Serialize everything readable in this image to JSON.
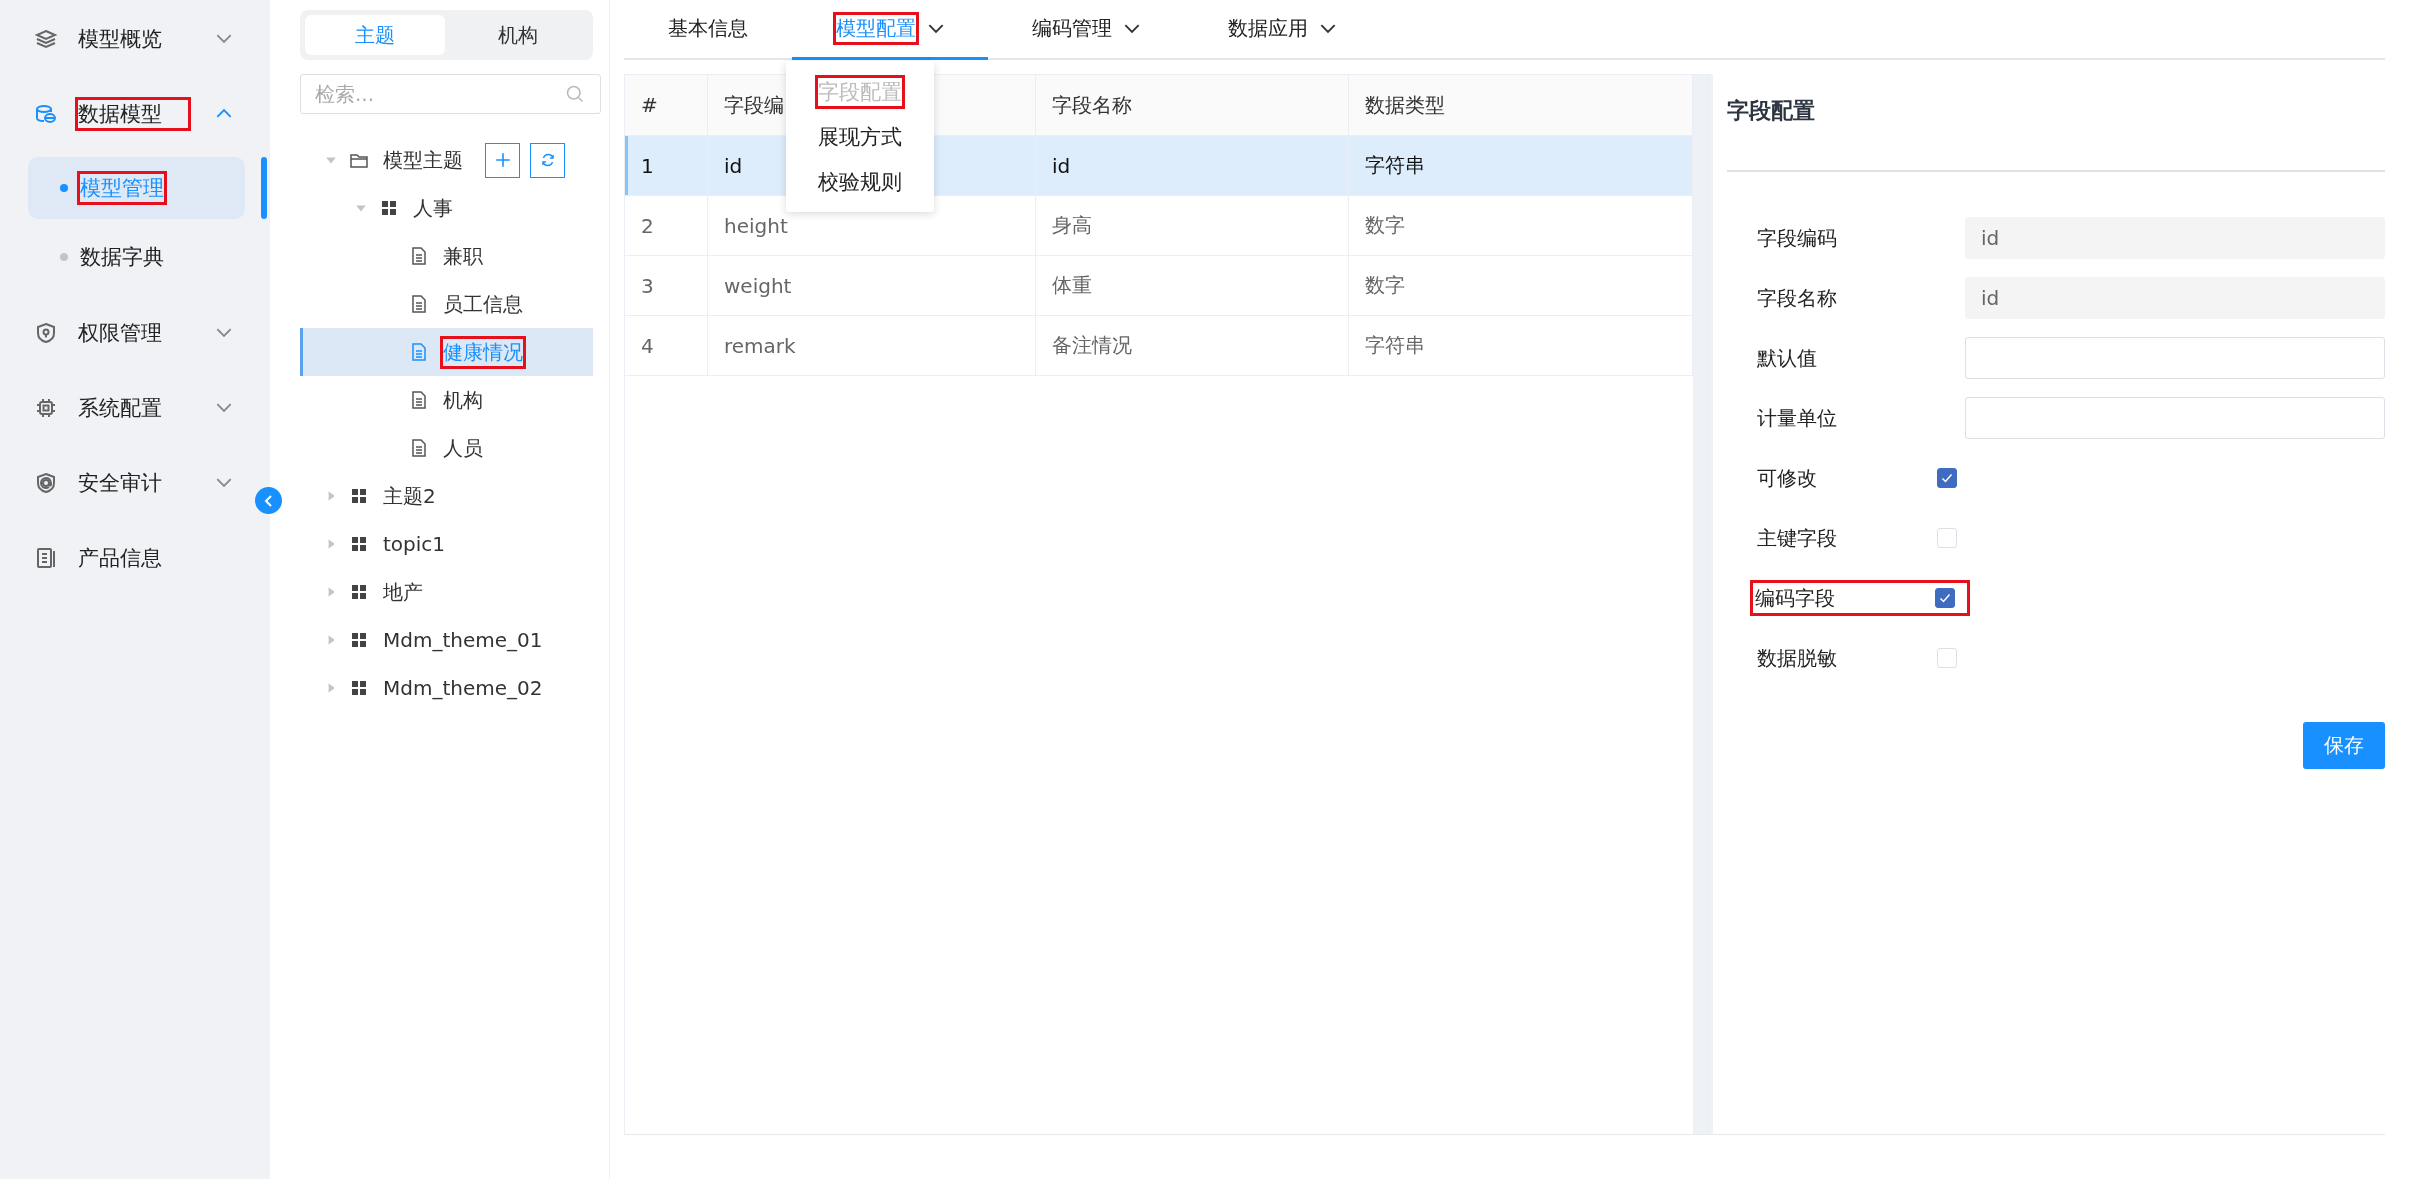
{
  "sidebar": {
    "items": [
      {
        "label": "模型概览",
        "expanded": false,
        "highlighted": false
      },
      {
        "label": "数据模型",
        "expanded": true,
        "highlighted": true,
        "children": [
          {
            "label": "模型管理",
            "selected": true,
            "highlighted": true
          },
          {
            "label": "数据字典",
            "selected": false,
            "highlighted": false
          }
        ]
      },
      {
        "label": "权限管理",
        "expanded": false,
        "highlighted": false
      },
      {
        "label": "系统配置",
        "expanded": false,
        "highlighted": false
      },
      {
        "label": "安全审计",
        "expanded": false,
        "highlighted": false
      },
      {
        "label": "产品信息",
        "highlighted": false
      }
    ]
  },
  "tree_panel": {
    "segments": [
      {
        "label": "主题",
        "selected": true
      },
      {
        "label": "机构",
        "selected": false
      }
    ],
    "search": {
      "placeholder": "检索..."
    },
    "nodes": [
      {
        "label": "模型主题",
        "kind": "folder",
        "expanded": true,
        "selected": false,
        "highlighted": false,
        "children": [
          {
            "label": "人事",
            "kind": "group",
            "expanded": true,
            "selected": false,
            "highlighted": false,
            "children": [
              {
                "label": "兼职",
                "kind": "doc",
                "selected": false,
                "highlighted": false
              },
              {
                "label": "员工信息",
                "kind": "doc",
                "selected": false,
                "highlighted": false
              },
              {
                "label": "健康情况",
                "kind": "doc",
                "selected": true,
                "highlighted": true
              },
              {
                "label": "机构",
                "kind": "doc",
                "selected": false,
                "highlighted": false
              },
              {
                "label": "人员",
                "kind": "doc",
                "selected": false,
                "highlighted": false
              }
            ]
          }
        ]
      },
      {
        "label": "主题2",
        "kind": "group",
        "expanded": false,
        "selected": false,
        "highlighted": false
      },
      {
        "label": "topic1",
        "kind": "group",
        "expanded": false,
        "selected": false,
        "highlighted": false
      },
      {
        "label": "地产",
        "kind": "group",
        "expanded": false,
        "selected": false,
        "highlighted": false
      },
      {
        "label": "Mdm_theme_01",
        "kind": "group",
        "expanded": false,
        "selected": false,
        "highlighted": false
      },
      {
        "label": "Mdm_theme_02",
        "kind": "group",
        "expanded": false,
        "selected": false,
        "highlighted": false
      }
    ]
  },
  "tabs": [
    {
      "label": "基本信息",
      "selected": false,
      "highlighted": false
    },
    {
      "label": "模型配置",
      "selected": true,
      "highlighted": true
    },
    {
      "label": "编码管理",
      "selected": false,
      "highlighted": false
    },
    {
      "label": "数据应用",
      "selected": false,
      "highlighted": false
    }
  ],
  "dropdown_menu": {
    "items": [
      {
        "label": "字段配置",
        "disabled": true,
        "highlighted": true
      },
      {
        "label": "展现方式",
        "disabled": false,
        "highlighted": false
      },
      {
        "label": "校验规则",
        "disabled": false,
        "highlighted": false
      }
    ]
  },
  "table": {
    "columns": [
      "#",
      "字段编",
      "字段名称",
      "数据类型"
    ],
    "rows": [
      {
        "cells": [
          "1",
          "id",
          "id",
          "字符串"
        ],
        "selected": true
      },
      {
        "cells": [
          "2",
          "height",
          "身高",
          "数字"
        ],
        "selected": false
      },
      {
        "cells": [
          "3",
          "weight",
          "体重",
          "数字"
        ],
        "selected": false
      },
      {
        "cells": [
          "4",
          "remark",
          "备注情况",
          "字符串"
        ],
        "selected": false
      }
    ]
  },
  "detail_panel": {
    "title": "字段配置",
    "fields": [
      {
        "label": "字段编码",
        "kind": "readonly",
        "value": "id",
        "highlighted": false
      },
      {
        "label": "字段名称",
        "kind": "readonly",
        "value": "id",
        "highlighted": false
      },
      {
        "label": "默认值",
        "kind": "input",
        "highlighted": false
      },
      {
        "label": "计量单位",
        "kind": "input",
        "highlighted": false
      },
      {
        "label": "可修改",
        "kind": "checkbox",
        "checked": true,
        "highlighted": false
      },
      {
        "label": "主键字段",
        "kind": "checkbox",
        "checked": false,
        "highlighted": false
      },
      {
        "label": "编码字段",
        "kind": "checkbox",
        "checked": true,
        "highlighted": true
      },
      {
        "label": "数据脱敏",
        "kind": "checkbox",
        "checked": false,
        "highlighted": false
      }
    ],
    "save_button": "保存"
  }
}
